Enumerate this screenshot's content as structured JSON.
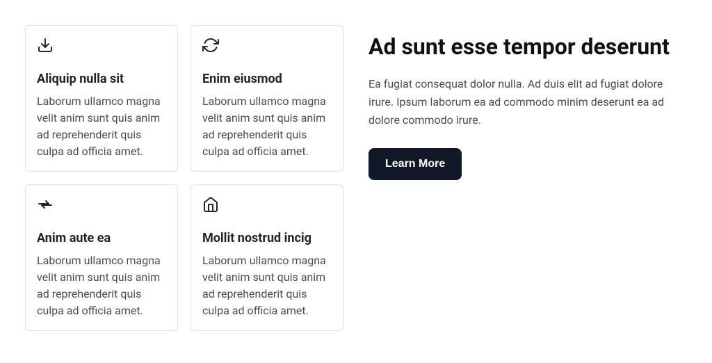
{
  "cards": [
    {
      "icon": "download",
      "title": "Aliquip nulla sit",
      "text": "Laborum ullamco magna velit anim sunt quis anim ad reprehenderit quis culpa ad officia amet."
    },
    {
      "icon": "refresh",
      "title": "Enim eiusmod",
      "text": "Laborum ullamco magna velit anim sunt quis anim ad reprehenderit quis culpa ad officia amet."
    },
    {
      "icon": "arrows-swap",
      "title": "Anim aute ea",
      "text": "Laborum ullamco magna velit anim sunt quis anim ad reprehenderit quis culpa ad officia amet."
    },
    {
      "icon": "home",
      "title": "Mollit nostrud incig",
      "text": "Laborum ullamco magna velit anim sunt quis anim ad reprehenderit quis culpa ad officia amet."
    }
  ],
  "hero": {
    "title": "Ad sunt esse tempor deserunt",
    "text": "Ea fugiat consequat dolor nulla. Ad duis elit ad fugiat dolore irure. Ipsum laborum ea ad commodo minim deserunt ea ad dolore commodo irure.",
    "button_label": "Learn More"
  }
}
